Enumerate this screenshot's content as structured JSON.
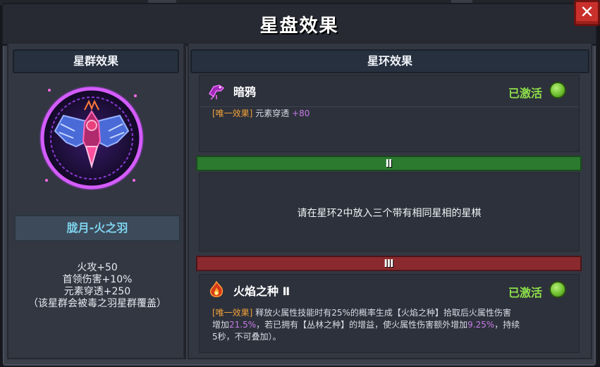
{
  "window": {
    "title": "星盘效果",
    "close_label": "✕"
  },
  "left_panel": {
    "header": "星群效果",
    "constellation_name": "胧月-火之羽",
    "stats": [
      "火攻+50",
      "首领伤害+10%",
      "元素穿透+250",
      "（该星群会被毒之羽星群覆盖）"
    ]
  },
  "right_panel": {
    "header": "星环效果",
    "ring1": {
      "name": "暗鸦",
      "icon": "raven-icon",
      "status": "已激活",
      "tag": "[唯一效果]",
      "text": "元素穿透",
      "value": "+80"
    },
    "ring2": {
      "numeral": "Ⅱ",
      "message": "请在星环2中放入三个带有相同星相的星棋"
    },
    "ring3": {
      "numeral": "Ⅲ",
      "name": "火焰之种 Ⅱ",
      "icon": "flame-seed-icon",
      "status": "已激活",
      "tag": "[唯一效果]",
      "line1": "释放火属性技能时有25%的概率生成【火焰之种】拾取后火属性伤害",
      "line2_a": "增加",
      "line2_v1": "21.5%",
      "line2_b": "，若已拥有【丛林之种】的增益，使火属性伤害额外增加",
      "line2_v2": "9.25%",
      "line2_c": "，持续",
      "line3": "5秒，不可叠加）。"
    }
  },
  "colors": {
    "active_green": "#8ee04a",
    "bar_green": "#2b7a2f",
    "bar_red": "#8a2a2e",
    "value_purple": "#c77be8",
    "tag_orange": "#f0a03a",
    "name_cyan": "#7fd4ee"
  }
}
